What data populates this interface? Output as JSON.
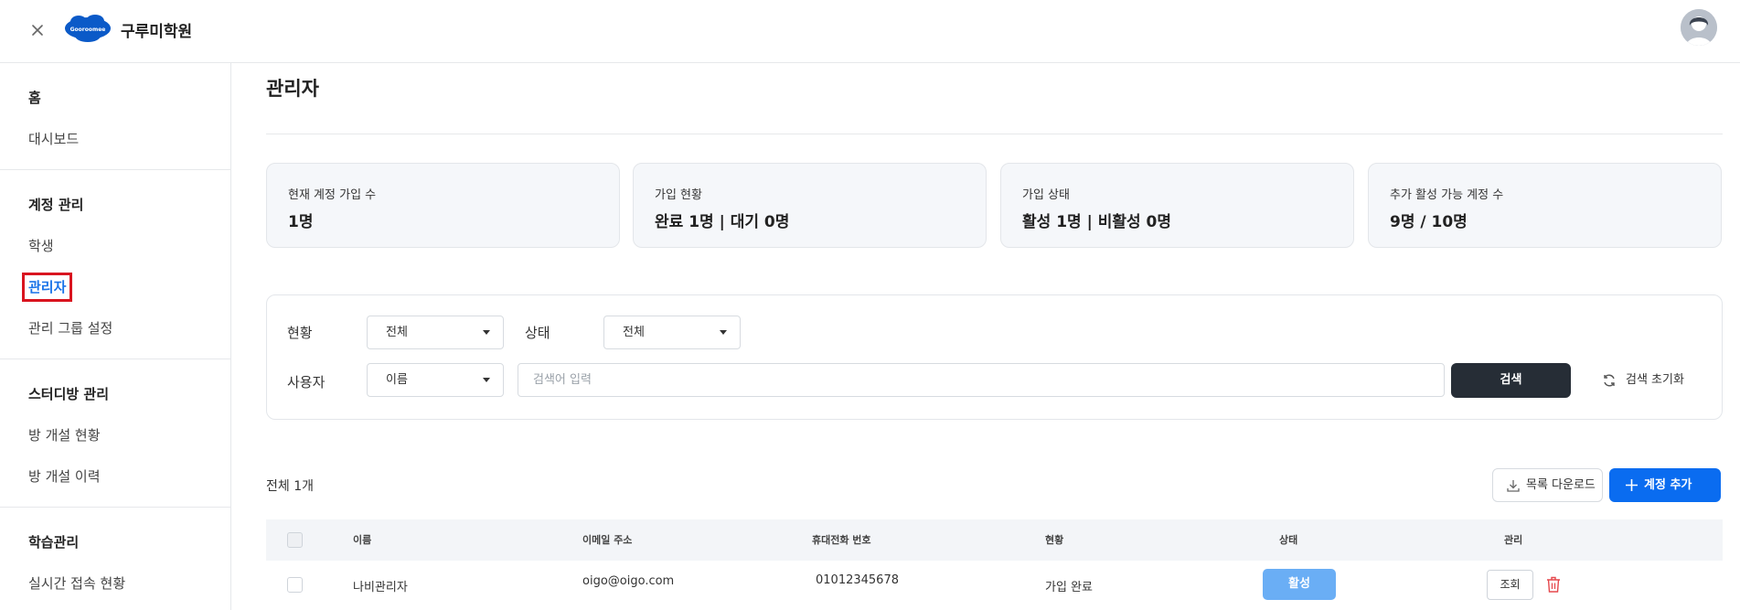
{
  "header": {
    "brand": "구루미학원",
    "logo_text": "Gooroomee",
    "colors": {
      "logo": "#0b5ac8"
    }
  },
  "sidebar": {
    "sections": [
      {
        "title": "홈",
        "items": [
          "대시보드"
        ]
      },
      {
        "title": "계정 관리",
        "items": [
          "학생",
          "관리자",
          "관리 그룹 설정"
        ]
      },
      {
        "title": "스터디방 관리",
        "items": [
          "방 개설 현황",
          "방 개설 이력"
        ]
      },
      {
        "title": "학습관리",
        "items": [
          "실시간 접속 현황"
        ]
      }
    ],
    "active_item": "관리자"
  },
  "main": {
    "title": "관리자",
    "stats": [
      {
        "label": "현재 계정 가입 수",
        "value": "1명"
      },
      {
        "label": "가입 현황",
        "value": "완료  1명 | 대기  0명"
      },
      {
        "label": "가입 상태",
        "value": "활성  1명 | 비활성  0명"
      },
      {
        "label": "추가 활성 가능 계정 수",
        "value": "9명 / 10명"
      }
    ],
    "filters": {
      "status_label": "현황",
      "status_value": "전체",
      "state_label": "상태",
      "state_value": "전체",
      "user_label": "사용자",
      "user_field_value": "이름",
      "search_placeholder": "검색어 입력",
      "search_button": "검색",
      "reset_button": "검색 초기화"
    },
    "total_label": "전체 1개",
    "download_button": "목록 다운로드",
    "add_button": "계정 추가",
    "table": {
      "columns": [
        "이름",
        "이메일 주소",
        "휴대전화 번호",
        "현황",
        "상태",
        "관리"
      ],
      "rows": [
        {
          "name": "나비관리자",
          "email": "oigo@oigo.com",
          "phone": "01012345678",
          "status": "가입 완료",
          "state": "활성",
          "manage": "조회"
        }
      ]
    },
    "colors": {
      "primary": "#0a6cf0",
      "active_pill": "#6aaef5",
      "dark_button": "#262d36",
      "delete": "#e5484d",
      "highlight": "#d9141f"
    }
  }
}
